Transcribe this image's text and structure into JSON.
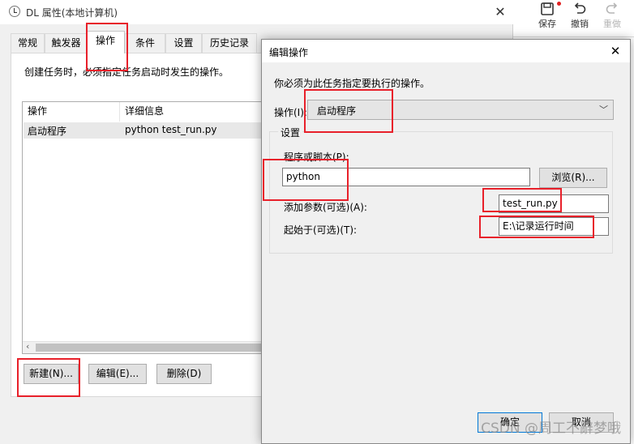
{
  "main_window": {
    "title": "DL 属性(本地计算机)",
    "tabs": [
      "常规",
      "触发器",
      "操作",
      "条件",
      "设置",
      "历史记录"
    ],
    "active_tab": "操作",
    "description": "创建任务时，必须指定任务启动时发生的操作。",
    "list": {
      "columns": [
        "操作",
        "详细信息"
      ],
      "rows": [
        {
          "action": "启动程序",
          "detail": "python test_run.py"
        }
      ]
    },
    "buttons": {
      "new": "新建(N)...",
      "edit": "编辑(E)...",
      "delete": "删除(D)"
    }
  },
  "toolbar": {
    "save": "保存",
    "undo": "撤销",
    "redo": "重做"
  },
  "dialog": {
    "title": "编辑操作",
    "description": "你必须为此任务指定要执行的操作。",
    "action_label": "操作(I):",
    "action_value": "启动程序",
    "settings_legend": "设置",
    "program_label": "程序或脚本(P):",
    "program_value": "python",
    "browse_button": "浏览(R)...",
    "args_label": "添加参数(可选)(A):",
    "args_value": "test_run.py",
    "start_in_label": "起始于(可选)(T):",
    "start_in_value": "E:\\记录运行时间",
    "ok_button": "确定",
    "cancel_button": "取消"
  },
  "watermark": "CSDN @周工不辭梦哦",
  "colors": {
    "annotation": "#e8202a",
    "accent": "#0078d7"
  }
}
